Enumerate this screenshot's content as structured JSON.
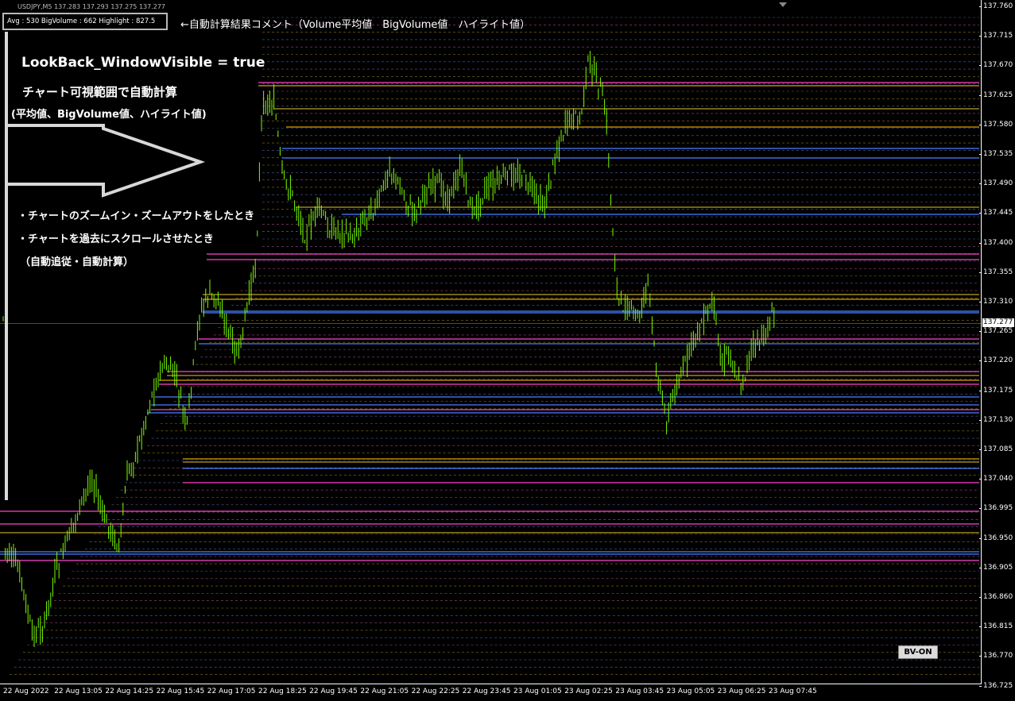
{
  "symbol_header": "USDJPY,M5  137.283 137.293 137.275 137.277",
  "stats_comment": "Avg : 530  BigVolume : 662  Highlight : 827.5",
  "annotations": {
    "comment_label": "←自動計算結果コメント（Volume平均値　BigVolume値　ハイライト値）",
    "setting": "LookBack_WindowVisible = true",
    "auto_calc": "チャート可視範囲で自動計算",
    "items": "(平均値、BigVolume値、ハイライト値)",
    "note_1": "・チャートのズームイン・ズームアウトをしたとき",
    "note_2": "・チャートを過去にスクロールさせたとき",
    "note_3": "（自動追従・自動計算）"
  },
  "bv_button_label": "BV-ON",
  "current_price": "137.277",
  "price_axis_labels": [
    "137.760",
    "137.715",
    "137.670",
    "137.625",
    "137.580",
    "137.535",
    "137.490",
    "137.445",
    "137.400",
    "137.355",
    "137.310",
    "137.265",
    "137.220",
    "137.175",
    "137.130",
    "137.085",
    "137.040",
    "136.995",
    "136.950",
    "136.905",
    "136.860",
    "136.815",
    "136.770",
    "136.725"
  ],
  "time_axis_labels": [
    "22 Aug 2022",
    "22 Aug 13:05",
    "22 Aug 14:25",
    "22 Aug 15:45",
    "22 Aug 17:05",
    "22 Aug 18:25",
    "22 Aug 19:45",
    "22 Aug 21:05",
    "22 Aug 22:25",
    "22 Aug 23:45",
    "23 Aug 01:05",
    "23 Aug 02:25",
    "23 Aug 03:45",
    "23 Aug 05:05",
    "23 Aug 06:25",
    "23 Aug 07:45"
  ],
  "colors": {
    "background": "#000000",
    "candle": "#7CFC00",
    "line_magenta": "#ff44cc",
    "line_blue": "#4a80ff",
    "line_olive": "#b8a020",
    "line_orange": "#e0a000",
    "line_pink_dotted": "#d060a0",
    "line_blue_dotted": "#6080d0",
    "arrow": "#d8d8d8"
  }
}
